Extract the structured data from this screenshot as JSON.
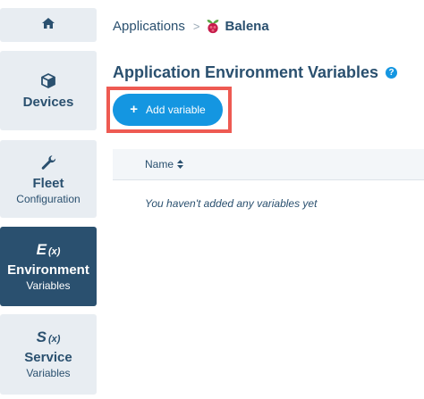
{
  "sidebar": {
    "home_icon": "home-icon",
    "devices": {
      "label": "Devices",
      "icon": "cube-icon"
    },
    "fleet": {
      "label": "Fleet",
      "sub": "Configuration",
      "icon": "wrench-icon"
    },
    "environment": {
      "symbol": "E",
      "symbol_sub": "(x)",
      "label": "Environment",
      "sub": "Variables"
    },
    "service": {
      "symbol": "S",
      "symbol_sub": "(x)",
      "label": "Service",
      "sub": "Variables"
    }
  },
  "breadcrumb": {
    "root": "Applications",
    "separator": ">",
    "app": "Balena",
    "app_icon": "raspberry-pi-icon"
  },
  "page": {
    "title": "Application Environment Variables",
    "help_icon": "?"
  },
  "add_button": {
    "icon": "+",
    "label": "Add variable"
  },
  "table": {
    "columns": [
      "Name"
    ],
    "empty_message": "You haven't added any variables yet"
  },
  "colors": {
    "accent": "#1496e1",
    "sidebar_active": "#2a506f",
    "highlight": "#ee5a52",
    "sidebar_bg": "#e8edf2"
  }
}
